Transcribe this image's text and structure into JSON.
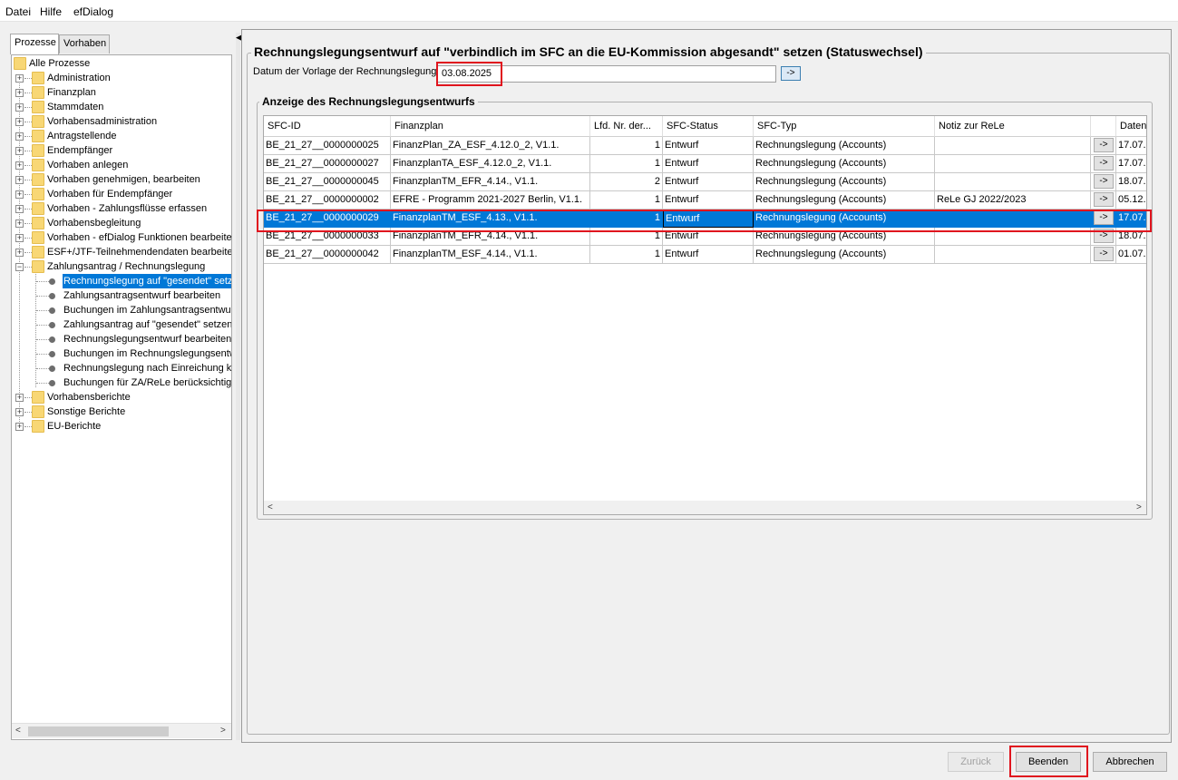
{
  "menu": {
    "items": [
      "Datei",
      "Hilfe",
      "efDialog"
    ]
  },
  "left_tabs": [
    "Prozesse",
    "Vorhaben"
  ],
  "tree": {
    "root": "Alle Prozesse",
    "items": [
      "Administration",
      "Finanzplan",
      "Stammdaten",
      "Vorhabensadministration",
      "Antragstellende",
      "Endempfänger",
      "Vorhaben anlegen",
      "Vorhaben genehmigen, bearbeiten",
      "Vorhaben für Endempfänger",
      "Vorhaben - Zahlungsflüsse erfassen",
      "Vorhabensbegleitung",
      "Vorhaben - efDialog Funktionen bearbeiten",
      "ESF+/JTF-Teilnehmendendaten bearbeiten",
      "Zahlungsantrag / Rechnungslegung"
    ],
    "children": [
      "Rechnungslegung auf \"gesendet\" setzen",
      "Zahlungsantragsentwurf bearbeiten",
      "Buchungen im Zahlungsantragsentwurf",
      "Zahlungsantrag auf \"gesendet\" setzen",
      "Rechnungslegungsentwurf bearbeiten",
      "Buchungen im Rechnungslegungsentwurf",
      "Rechnungslegung nach Einreichung korrigieren",
      "Buchungen für ZA/ReLe berücksichtigen"
    ],
    "after": [
      "Vorhabensberichte",
      "Sonstige Berichte",
      "EU-Berichte"
    ]
  },
  "form": {
    "title": "Rechnungslegungsentwurf auf \"verbindlich im SFC an die EU-Kommission abgesandt\" setzen (Statuswechsel)",
    "date_label": "Datum der Vorlage der Rechnungslegung",
    "date_value": "03.08.2025",
    "arrow": "->",
    "section_title": "Anzeige des Rechnungslegungsentwurfs"
  },
  "table": {
    "columns": [
      "SFC-ID",
      "Finanzplan",
      "Lfd. Nr. der...",
      "SFC-Status",
      "SFC-Typ",
      "Notiz zur ReLe",
      "",
      "Daten"
    ],
    "rows": [
      [
        "BE_21_27__0000000025",
        "FinanzPlan_ZA_ESF_4.12.0_2, V1.1.",
        "1",
        "Entwurf",
        "Rechnungslegung (Accounts)",
        "",
        "->",
        "17.07."
      ],
      [
        "BE_21_27__0000000027",
        "FinanzplanTA_ESF_4.12.0_2, V1.1.",
        "1",
        "Entwurf",
        "Rechnungslegung (Accounts)",
        "",
        "->",
        "17.07."
      ],
      [
        "BE_21_27__0000000045",
        "FinanzplanTM_EFR_4.14., V1.1.",
        "2",
        "Entwurf",
        "Rechnungslegung (Accounts)",
        "",
        "->",
        "18.07."
      ],
      [
        "BE_21_27__0000000002",
        "EFRE - Programm 2021-2027 Berlin, V1.1.",
        "1",
        "Entwurf",
        "Rechnungslegung (Accounts)",
        "ReLe GJ 2022/2023",
        "->",
        "05.12."
      ],
      [
        "BE_21_27__0000000029",
        "FinanzplanTM_ESF_4.13., V1.1.",
        "1",
        "Entwurf",
        "Rechnungslegung (Accounts)",
        "",
        "->",
        "17.07."
      ],
      [
        "BE_21_27__0000000033",
        "FinanzplanTM_EFR_4.14., V1.1.",
        "1",
        "Entwurf",
        "Rechnungslegung (Accounts)",
        "",
        "->",
        "18.07."
      ],
      [
        "BE_21_27__0000000042",
        "FinanzplanTM_ESF_4.14., V1.1.",
        "1",
        "Entwurf",
        "Rechnungslegung (Accounts)",
        "",
        "->",
        "01.07."
      ]
    ],
    "selected_row": 4
  },
  "buttons": {
    "back": "Zurück",
    "finish": "Beenden",
    "cancel": "Abbrechen"
  },
  "colors": {
    "selection": "#0078d7",
    "highlight": "#e0141e",
    "folder": "#f8d775"
  }
}
